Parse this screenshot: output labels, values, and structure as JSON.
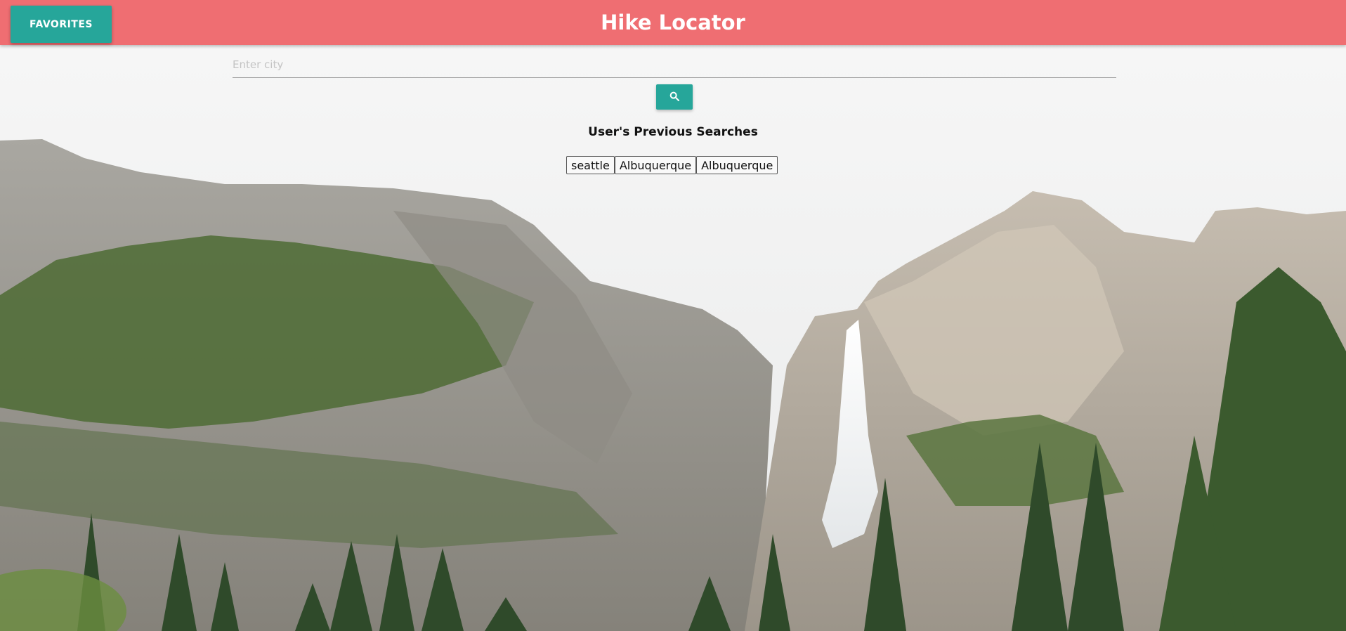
{
  "header": {
    "title": "Hike Locator",
    "favorites_label": "FAVORITES"
  },
  "search": {
    "placeholder": "Enter city",
    "value": "",
    "button_icon": "search-icon"
  },
  "previous_searches": {
    "title": "User's Previous Searches",
    "items": [
      "seattle",
      "Albuquerque",
      "Albuquerque"
    ]
  },
  "colors": {
    "header": "#ef6e72",
    "accent": "#26a69a"
  }
}
